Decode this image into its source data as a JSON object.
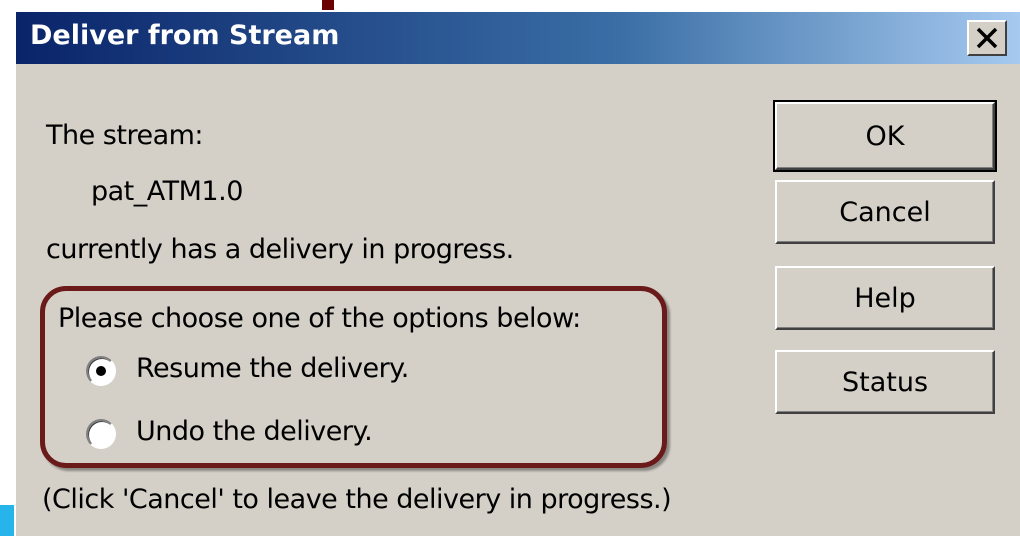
{
  "dialog": {
    "title": "Deliver from Stream",
    "close_glyph": "X",
    "line_stream": "The stream:",
    "stream_name": "pat_ATM1.0",
    "line_progress": "currently has a delivery in progress.",
    "options_prompt": "Please choose one of the options below:",
    "options": [
      {
        "label": "Resume the delivery.",
        "selected": true
      },
      {
        "label": "Undo the delivery.",
        "selected": false
      }
    ],
    "footer_note": "(Click 'Cancel' to leave the delivery in progress.)"
  },
  "buttons": {
    "ok": "OK",
    "cancel": "Cancel",
    "help": "Help",
    "status": "Status"
  },
  "colors": {
    "title_gradient_start": "#0a246a",
    "title_gradient_end": "#a6caf0",
    "dialog_bg": "#d4d0c8",
    "highlight_frame": "#6b1a1a"
  },
  "icons": {
    "close": "close-icon"
  }
}
